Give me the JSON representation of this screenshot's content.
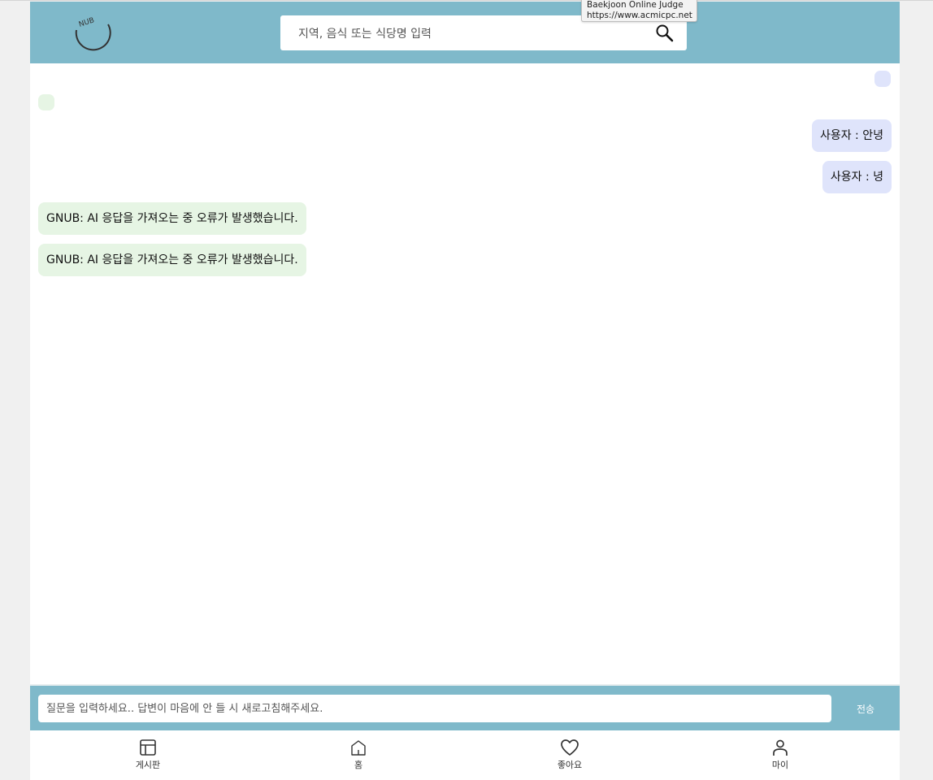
{
  "tooltip": {
    "title": "Baekjoon Online Judge",
    "url": "https://www.acmicpc.net"
  },
  "header": {
    "logo_text": "NUB",
    "search_placeholder": "지역, 음식 또는 식당명 입력"
  },
  "chat": {
    "messages": [
      {
        "role": "user",
        "text": "사용자 : 안녕"
      },
      {
        "role": "user",
        "text": "사용자 : 녕"
      },
      {
        "role": "bot",
        "text": "GNUB: AI 응답을 가져오는 중 오류가 발생했습니다."
      },
      {
        "role": "bot",
        "text": "GNUB: AI 응답을 가져오는 중 오류가 발생했습니다."
      }
    ]
  },
  "input": {
    "placeholder": "질문을 입력하세요.. 답변이 마음에 안 들 시 새로고침해주세요.",
    "send_label": "전송"
  },
  "nav": {
    "items": [
      {
        "label": "게시판",
        "icon": "board-icon"
      },
      {
        "label": "홈",
        "icon": "home-icon"
      },
      {
        "label": "좋아요",
        "icon": "heart-icon"
      },
      {
        "label": "마이",
        "icon": "person-icon"
      }
    ]
  },
  "colors": {
    "header": "#7fb9ca",
    "user_bubble": "#dfe4fb",
    "bot_bubble": "#e6f5e4"
  }
}
